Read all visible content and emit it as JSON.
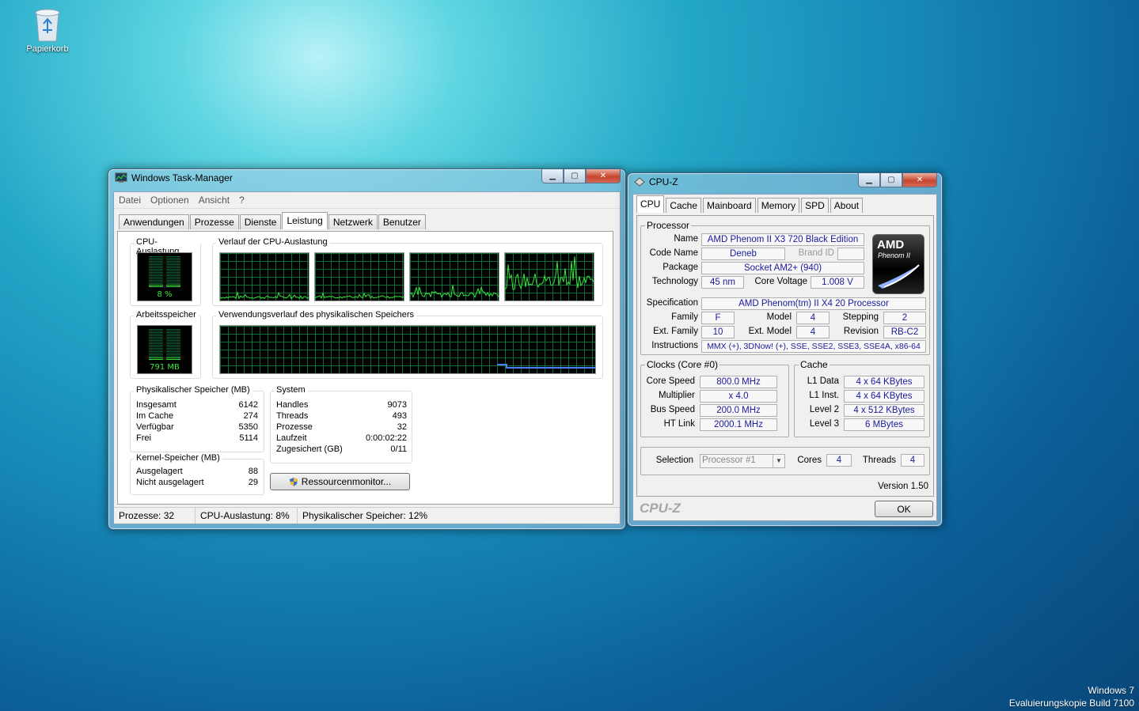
{
  "desktop": {
    "recycle_bin_label": "Papierkorb"
  },
  "watermark": {
    "line1": "Windows 7",
    "line2": "Evaluierungskopie Build 7100"
  },
  "taskmgr": {
    "title": "Windows Task-Manager",
    "menu": [
      "Datei",
      "Optionen",
      "Ansicht",
      "?"
    ],
    "tabs": [
      "Anwendungen",
      "Prozesse",
      "Dienste",
      "Leistung",
      "Netzwerk",
      "Benutzer"
    ],
    "active_tab": 3,
    "cpu_usage_label": "CPU-Auslastung",
    "cpu_usage_value": "8 %",
    "cpu_usage_fraction": 0.08,
    "cpu_history_label": "Verlauf der CPU-Auslastung",
    "mem_label": "Arbeitsspeicher",
    "mem_value": "791 MB",
    "mem_fraction": 0.12,
    "mem_history_label": "Verwendungsverlauf des physikalischen Speichers",
    "physical": {
      "label": "Physikalischer Speicher (MB)",
      "rows": [
        [
          "Insgesamt",
          "6142"
        ],
        [
          "Im Cache",
          "274"
        ],
        [
          "Verfügbar",
          "5350"
        ],
        [
          "Frei",
          "5114"
        ]
      ]
    },
    "kernel": {
      "label": "Kernel-Speicher (MB)",
      "rows": [
        [
          "Ausgelagert",
          "88"
        ],
        [
          "Nicht ausgelagert",
          "29"
        ]
      ]
    },
    "system": {
      "label": "System",
      "rows": [
        [
          "Handles",
          "9073"
        ],
        [
          "Threads",
          "493"
        ],
        [
          "Prozesse",
          "32"
        ],
        [
          "Laufzeit",
          "0:00:02:22"
        ],
        [
          "Zugesichert (GB)",
          "0/11"
        ]
      ]
    },
    "resource_button": "Ressourcenmonitor...",
    "status": [
      "Prozesse: 32",
      "CPU-Auslastung: 8%",
      "Physikalischer Speicher: 12%"
    ]
  },
  "cpuz": {
    "title": "CPU-Z",
    "tabs": [
      "CPU",
      "Cache",
      "Mainboard",
      "Memory",
      "SPD",
      "About"
    ],
    "active_tab": 0,
    "processor_label": "Processor",
    "name_label": "Name",
    "name": "AMD Phenom II X3 720 Black Edition",
    "codename_label": "Code Name",
    "codename": "Deneb",
    "brandid_label": "Brand ID",
    "brandid": "",
    "package_label": "Package",
    "package": "Socket AM2+ (940)",
    "technology_label": "Technology",
    "technology": "45 nm",
    "voltage_label": "Core Voltage",
    "voltage": "1.008 V",
    "spec_label": "Specification",
    "spec": "AMD Phenom(tm) II X4 20 Processor",
    "family_label": "Family",
    "family": "F",
    "model_label": "Model",
    "model": "4",
    "stepping_label": "Stepping",
    "stepping": "2",
    "extfamily_label": "Ext. Family",
    "extfamily": "10",
    "extmodel_label": "Ext. Model",
    "extmodel": "4",
    "revision_label": "Revision",
    "revision": "RB-C2",
    "instructions_label": "Instructions",
    "instructions": "MMX (+), 3DNow! (+), SSE, SSE2, SSE3, SSE4A, x86-64",
    "logo_line1": "AMD",
    "logo_line2": "Phenom II",
    "clocks_label": "Clocks (Core #0)",
    "corespeed_label": "Core Speed",
    "corespeed": "800.0 MHz",
    "multiplier_label": "Multiplier",
    "multiplier": "x 4.0",
    "busspeed_label": "Bus Speed",
    "busspeed": "200.0 MHz",
    "htlink_label": "HT Link",
    "htlink": "2000.1 MHz",
    "cache_label": "Cache",
    "l1data_label": "L1 Data",
    "l1data": "4 x 64 KBytes",
    "l1inst_label": "L1 Inst.",
    "l1inst": "4 x 64 KBytes",
    "level2_label": "Level 2",
    "level2": "4 x 512 KBytes",
    "level3_label": "Level 3",
    "level3": "6 MBytes",
    "selection_label": "Selection",
    "selection": "Processor #1",
    "cores_label": "Cores",
    "cores": "4",
    "threads_label": "Threads",
    "threads": "4",
    "version": "Version 1.50",
    "brand": "CPU-Z",
    "ok": "OK"
  },
  "colors": {
    "graph_line": "#35e83b",
    "grid": "#0b6e34",
    "mem_line": "#4a7dff",
    "value_text": "#1a1a9a"
  }
}
